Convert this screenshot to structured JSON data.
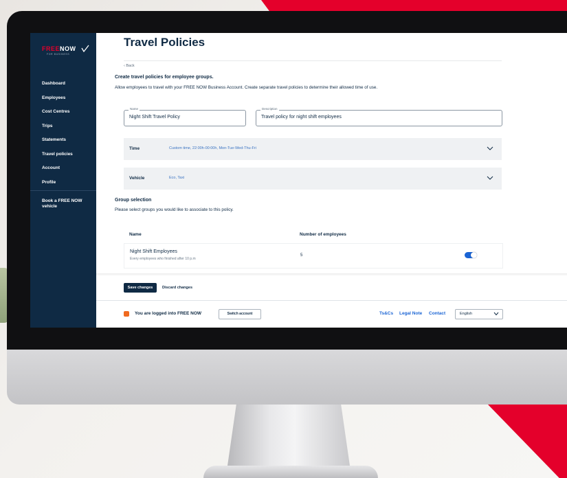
{
  "sidebar": {
    "logo": {
      "free": "FREE",
      "now": "NOW",
      "sub": "FOR BUSINESS"
    },
    "items": [
      {
        "label": "Dashboard"
      },
      {
        "label": "Employees"
      },
      {
        "label": "Cost Centres"
      },
      {
        "label": "Trips"
      },
      {
        "label": "Statements"
      },
      {
        "label": "Travel policies"
      },
      {
        "label": "Account"
      },
      {
        "label": "Profile"
      }
    ],
    "book": "Book a FREE NOW vehicle"
  },
  "main": {
    "title": "Travel Policies",
    "back": "‹ Back",
    "intro_title": "Create travel policies for employee groups.",
    "intro_text": "Allow employees to travel with your FREE NOW Business Account. Create separate travel policies to determine their allowed time of use.",
    "name_field": {
      "label": "Name",
      "value": "Night Shift Travel Policy"
    },
    "description_field": {
      "label": "Description",
      "value": "Travel policy for night shift employees"
    },
    "time": {
      "label": "Time",
      "value": "Custom time, 22:00h-00:00h, Mon-Tue-Wed-Thu-Fri"
    },
    "vehicle": {
      "label": "Vehicle",
      "value": "Eco, Taxi"
    },
    "group_title": "Group selection",
    "group_text": "Please select groups you would like to associate to this policy.",
    "table": {
      "headers": [
        "Name",
        "Number of employees"
      ],
      "rows": [
        {
          "name": "Night Shift Employees",
          "desc": "Every employees who finished after 10 p.m",
          "count": "5",
          "enabled": true
        }
      ]
    },
    "save_label": "Save changes",
    "discard_label": "Discard changes"
  },
  "footer": {
    "logged_text": "You are logged into FREE NOW",
    "switch_label": "Switch account",
    "links": [
      "Ts&Cs",
      "Legal Note",
      "Contact"
    ],
    "language": "English"
  },
  "colors": {
    "brand_red": "#e4002b",
    "sidebar_navy": "#0f2a44",
    "link_blue": "#1a64d4",
    "footer_icon_orange": "#f06a1f"
  }
}
